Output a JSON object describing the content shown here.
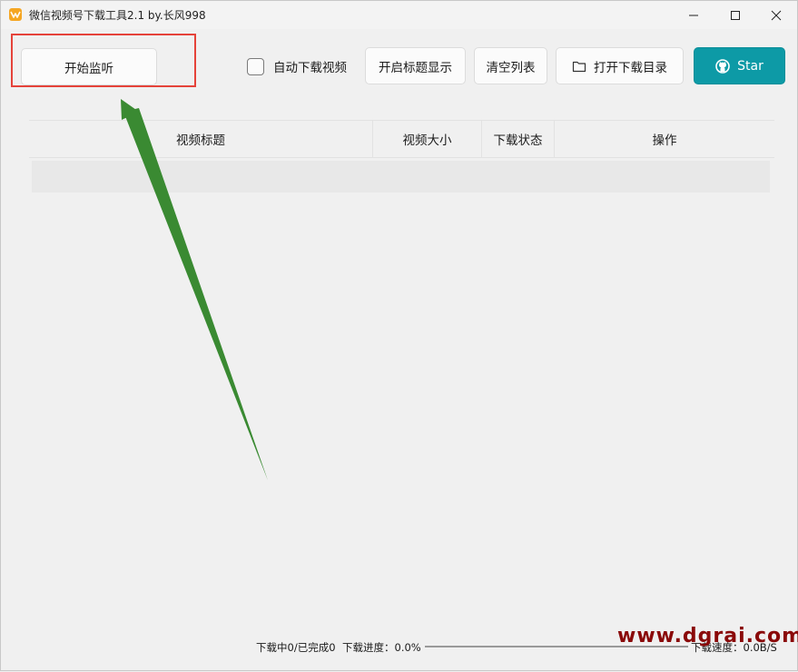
{
  "window": {
    "title": "微信视频号下载工具2.1 by.长风998",
    "icon": "app-logo-icon",
    "controls": [
      "minimize-icon",
      "maximize-icon",
      "close-icon"
    ]
  },
  "toolbar": {
    "monitor_label": "开始监听",
    "auto_download_label": "自动下载视频",
    "auto_download_checked": false,
    "show_title_label": "开启标题显示",
    "clear_list_label": "清空列表",
    "open_dir_label": "打开下载目录",
    "star_label": "Star"
  },
  "table": {
    "columns": [
      "视频标题",
      "视频大小",
      "下载状态",
      "操作"
    ],
    "rows": []
  },
  "status": {
    "counts": "下载中0/已完成0",
    "progress_label": "下载进度：0.0%",
    "progress_value": 0.0,
    "speed_label": "下载速度：0.0B/S"
  },
  "watermark": "www.dgrai.com",
  "colors": {
    "accent": "#0d9aa6",
    "highlight": "#e5433a",
    "arrow": "#3a8a32"
  }
}
